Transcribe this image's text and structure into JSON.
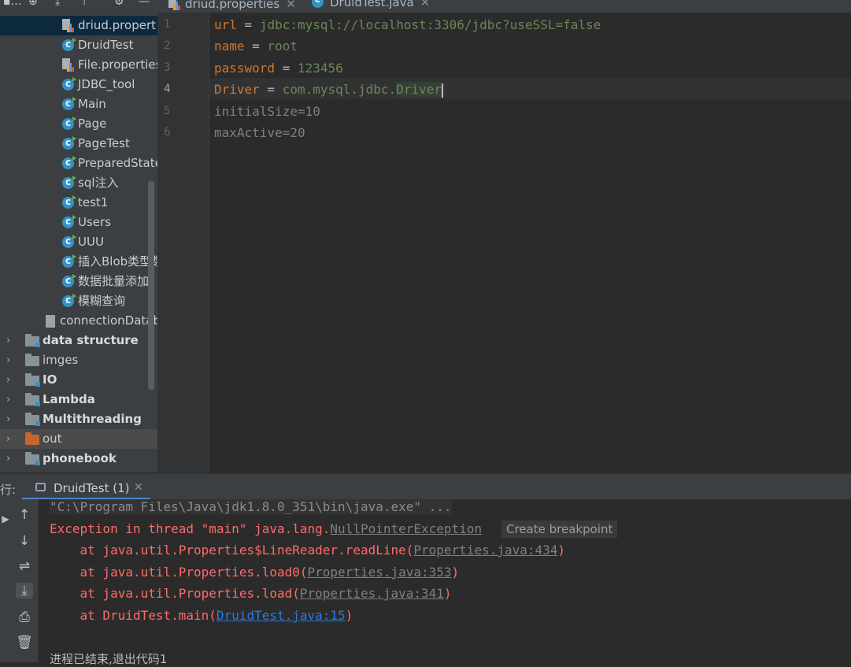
{
  "project_tree": {
    "items": [
      {
        "label": "driud.propert",
        "icon": "properties-icon"
      },
      {
        "label": "DruidTest",
        "icon": "class-icon"
      },
      {
        "label": "File.properties",
        "icon": "properties-icon"
      },
      {
        "label": "JDBC_tool",
        "icon": "class-icon"
      },
      {
        "label": "Main",
        "icon": "class-icon"
      },
      {
        "label": "Page",
        "icon": "class-icon"
      },
      {
        "label": "PageTest",
        "icon": "class-icon"
      },
      {
        "label": "PreparedState",
        "icon": "class-icon"
      },
      {
        "label": "sql注入",
        "icon": "class-icon"
      },
      {
        "label": "test1",
        "icon": "class-icon"
      },
      {
        "label": "Users",
        "icon": "class-icon"
      },
      {
        "label": "UUU",
        "icon": "class-icon"
      },
      {
        "label": "插入Blob类型数",
        "icon": "class-icon"
      },
      {
        "label": "数据批量添加",
        "icon": "class-icon"
      },
      {
        "label": "模糊查询",
        "icon": "class-icon"
      },
      {
        "label": "connectionDatab",
        "icon": "file-icon"
      },
      {
        "label": "data structure",
        "icon": "module-folder-icon"
      },
      {
        "label": "imges",
        "icon": "folder-icon"
      },
      {
        "label": "IO",
        "icon": "module-folder-icon"
      },
      {
        "label": "Lambda",
        "icon": "module-folder-icon"
      },
      {
        "label": "Multithreading",
        "icon": "module-folder-icon"
      },
      {
        "label": "out",
        "icon": "excluded-folder-icon"
      },
      {
        "label": "phonebook",
        "icon": "module-folder-icon"
      }
    ]
  },
  "editor": {
    "tabs": [
      {
        "label": "driud.properties",
        "active": true
      },
      {
        "label": "DruidTest.java",
        "active": false
      }
    ],
    "line_numbers": [
      "1",
      "2",
      "3",
      "4",
      "5",
      "6"
    ],
    "lines": {
      "l1": {
        "key": "url",
        "op": " = ",
        "val": "jdbc:mysql://localhost:3306/jdbc?useSSL=false"
      },
      "l2": {
        "key": "name",
        "op": " = ",
        "val": "root"
      },
      "l3": {
        "key": "password",
        "op": " = ",
        "val": "123456"
      },
      "l4": {
        "key": "Driver",
        "op": " = ",
        "val_a": "com.mysql.jdbc.",
        "val_b": "Driver"
      },
      "l5": {
        "text": "initialSize=10"
      },
      "l6": {
        "text": "maxActive=20"
      }
    }
  },
  "run_panel": {
    "label": "行:",
    "tab_label": "DruidTest (1)",
    "console": {
      "cmd": "\"C:\\Program Files\\Java\\jdk1.8.0_351\\bin\\java.exe\" ...",
      "exception_prefix": "Exception in thread \"main\" java.lang.",
      "exception_name": "NullPointerException",
      "create_breakpoint": "Create breakpoint",
      "stack": [
        {
          "prefix": "    at java.util.Properties$LineReader.readLine(",
          "link": "Properties.java:434",
          "suffix": ")"
        },
        {
          "prefix": "    at java.util.Properties.load0(",
          "link": "Properties.java:353",
          "suffix": ")"
        },
        {
          "prefix": "    at java.util.Properties.load(",
          "link": "Properties.java:341",
          "suffix": ")"
        },
        {
          "prefix": "    at DruidTest.main(",
          "link": "DruidTest.java:15",
          "suffix": ")"
        }
      ],
      "exit": "进程已结束,退出代码1"
    }
  },
  "colors": {
    "keyword": "#cc7832",
    "value": "#6a8759",
    "error": "#ff6b68",
    "link": "#287bde",
    "accent": "#4a88c7"
  }
}
